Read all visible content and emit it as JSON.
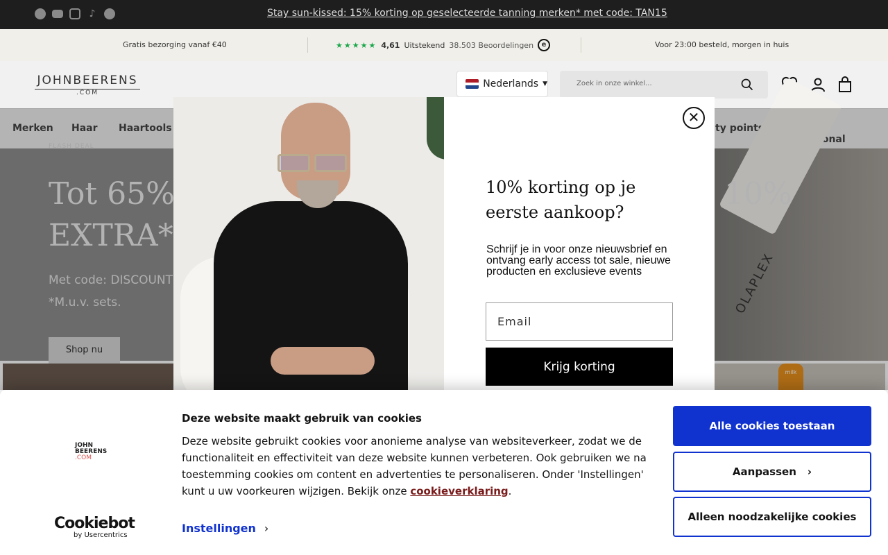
{
  "announcement": {
    "text": "Stay sun-kissed: 15% korting op geselecteerde tanning merken* met code: TAN15",
    "social_icons": [
      "facebook-icon",
      "youtube-icon",
      "instagram-icon",
      "tiktok-icon",
      "pinterest-icon"
    ]
  },
  "usp": {
    "left": "Gratis bezorging vanaf €40",
    "rating": "4,61",
    "rating_label": "Uitstekend",
    "reviews": "38.503 Beoordelingen",
    "right": "Voor 23:00 besteld, morgen in huis"
  },
  "header": {
    "logo_top": "JOHNBEERENS",
    "logo_bottom": ".COM",
    "language": "Nederlands",
    "search_placeholder": "Zoek in onze winkel..."
  },
  "nav": {
    "items": [
      "Merken",
      "Haar",
      "Haartools"
    ],
    "right_items": [
      "ty points",
      "Inloggen Professional"
    ]
  },
  "hero": {
    "eyebrow": "FLASH DEAL",
    "title_line1": "Tot 65%",
    "title_line2": "EXTRA*",
    "title_right": "10%",
    "sub_line1": "Met code: DISCOUNT",
    "sub_line2": "*M.u.v. sets.",
    "button": "Shop nu",
    "bottle_text": "OLAPLEX"
  },
  "popup": {
    "close_label": "✕",
    "title": "10% korting op je eerste aankoop?",
    "text": "Schrijf je in voor onze nieuwsbrief en ontvang early access tot sale, nieuwe producten en exclusieve events",
    "email_placeholder": "Email",
    "button": "Krijg korting"
  },
  "cookie": {
    "logo_line1": "JOHN",
    "logo_line2": "BEERENS",
    "logo_line3": ".COM",
    "title": "Deze website maakt gebruik van cookies",
    "text": "Deze website gebruikt cookies voor anonieme analyse van websiteverkeer, zodat we de functionaliteit en effectiviteit van deze website kunnen verbeteren. Ook gebruiken we na toestemming cookies om content en advertenties te personaliseren. Onder 'Instellingen' kunt u uw voorkeuren wijzigen. Bekijk onze ",
    "link": "cookieverklaring",
    "text_end": ".",
    "settings": "Instellingen",
    "brand": "Cookiebot",
    "brand_by": "by Usercentrics",
    "btn_all": "Alle cookies toestaan",
    "btn_adjust": "Aanpassen",
    "btn_necessary": "Alleen noodzakelijke cookies",
    "accent_color": "#1032cf"
  }
}
